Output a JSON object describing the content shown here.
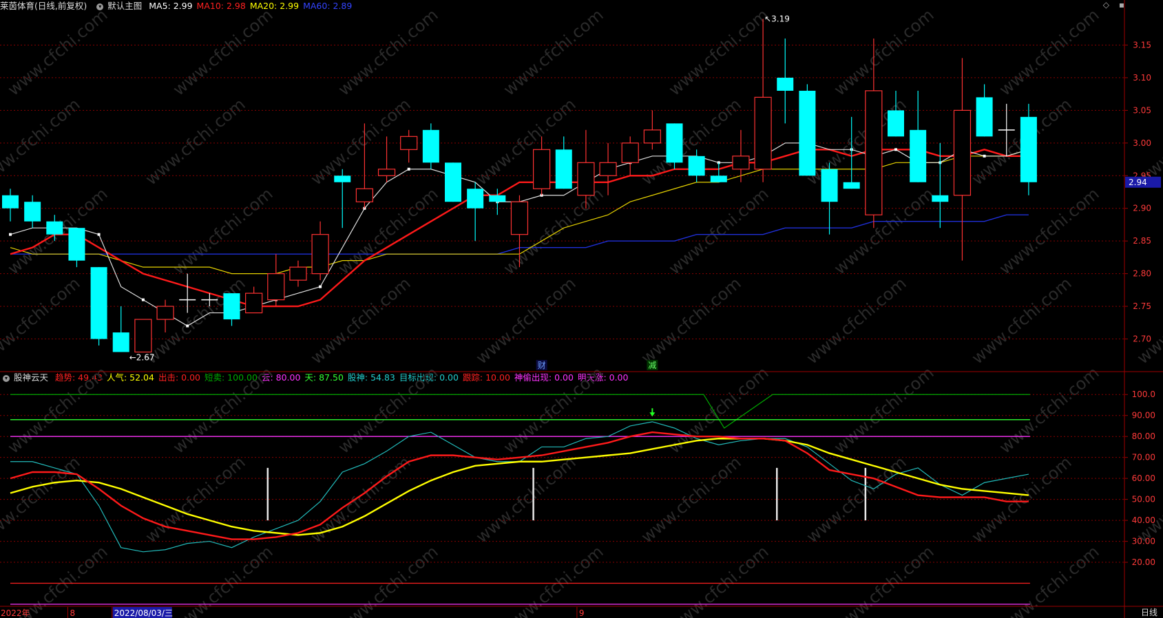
{
  "header": {
    "stock_name": "莱茵体育",
    "mode": "(日线,前复权)",
    "chart_mode": "默认主图",
    "ma": [
      {
        "label": "MA5:",
        "value": "2.99",
        "color": "#ffffff"
      },
      {
        "label": "MA10:",
        "value": "2.98",
        "color": "#ff2020"
      },
      {
        "label": "MA20:",
        "value": "2.99",
        "color": "#ffff00"
      },
      {
        "label": "MA60:",
        "value": "2.89",
        "color": "#3344ff"
      }
    ]
  },
  "window_controls": {
    "diamond": "◇",
    "close": "▪"
  },
  "indicator_header": {
    "name": "股神云天",
    "items": [
      {
        "label": "趋势:",
        "value": "49.43",
        "color": "#ff2020"
      },
      {
        "label": "人气:",
        "value": "52.04",
        "color": "#ffff00"
      },
      {
        "label": "出击:",
        "value": "0.00",
        "color": "#ff2020"
      },
      {
        "label": "短卖:",
        "value": "100.00",
        "color": "#00aa00"
      },
      {
        "label": "云:",
        "value": "80.00",
        "color": "#ff33ff"
      },
      {
        "label": "天:",
        "value": "87.50",
        "color": "#33ff33"
      },
      {
        "label": "股神:",
        "value": "54.83",
        "color": "#22cccc"
      },
      {
        "label": "目标出现:",
        "value": "0.00",
        "color": "#22cccc"
      },
      {
        "label": "跟踪:",
        "value": "10.00",
        "color": "#ff2020"
      },
      {
        "label": "神偷出现:",
        "value": "0.00",
        "color": "#ff33ff"
      },
      {
        "label": "明天涨:",
        "value": "0.00",
        "color": "#ff33ff"
      }
    ]
  },
  "price_axis": {
    "min": 2.65,
    "max": 3.2,
    "ticks": [
      "3.15",
      "3.10",
      "3.05",
      "3.00",
      "2.95",
      "2.90",
      "2.85",
      "2.80",
      "2.75",
      "2.70"
    ],
    "current_price": "2.94"
  },
  "indicator_axis": {
    "ticks": [
      "100.0",
      "90.00",
      "80.00",
      "70.00",
      "60.00",
      "50.00",
      "40.00",
      "30.00",
      "20.00"
    ]
  },
  "annotations": {
    "high": "3.19",
    "low": "←2.67",
    "high_prefix": "↖"
  },
  "event_markers": [
    {
      "text": "财",
      "index": 24
    },
    {
      "text": "减",
      "index": 29
    }
  ],
  "date_axis": {
    "labels": [
      {
        "text": "2022年",
        "index": 0
      },
      {
        "text": "8",
        "index": 3
      },
      {
        "text": "2022/08/03/三",
        "index": 5,
        "highlight": true
      },
      {
        "text": "9",
        "index": 26
      }
    ],
    "period": "日线"
  },
  "watermark": "www.cfchi.com",
  "colors": {
    "up": "#ff3232",
    "down": "#00ffff",
    "doji": "#ffffff",
    "grid": "#8b0000",
    "border": "#a00000"
  },
  "chart_data": {
    "type": "candlestick",
    "candles": [
      [
        2.92,
        2.93,
        2.88,
        2.9
      ],
      [
        2.91,
        2.92,
        2.87,
        2.88
      ],
      [
        2.88,
        2.89,
        2.85,
        2.86
      ],
      [
        2.87,
        2.87,
        2.81,
        2.82
      ],
      [
        2.81,
        2.81,
        2.69,
        2.7
      ],
      [
        2.71,
        2.75,
        2.68,
        2.68
      ],
      [
        2.68,
        2.73,
        2.68,
        2.73
      ],
      [
        2.73,
        2.76,
        2.71,
        2.75
      ],
      [
        2.76,
        2.8,
        2.74,
        2.76
      ],
      [
        2.76,
        2.77,
        2.75,
        2.76
      ],
      [
        2.77,
        2.77,
        2.72,
        2.73
      ],
      [
        2.74,
        2.78,
        2.74,
        2.77
      ],
      [
        2.76,
        2.83,
        2.75,
        2.8
      ],
      [
        2.79,
        2.82,
        2.78,
        2.81
      ],
      [
        2.8,
        2.88,
        2.79,
        2.86
      ],
      [
        2.95,
        2.96,
        2.87,
        2.94
      ],
      [
        2.91,
        3.03,
        2.9,
        2.93
      ],
      [
        2.95,
        3.01,
        2.94,
        2.96
      ],
      [
        2.99,
        3.02,
        2.97,
        3.01
      ],
      [
        3.02,
        3.03,
        2.96,
        2.97
      ],
      [
        2.97,
        2.97,
        2.91,
        2.91
      ],
      [
        2.93,
        2.94,
        2.85,
        2.9
      ],
      [
        2.92,
        2.93,
        2.89,
        2.91
      ],
      [
        2.86,
        2.92,
        2.81,
        2.91
      ],
      [
        2.93,
        3.01,
        2.92,
        2.99
      ],
      [
        2.99,
        3.01,
        2.93,
        2.93
      ],
      [
        2.92,
        3.02,
        2.9,
        2.97
      ],
      [
        2.95,
        3.0,
        2.92,
        2.97
      ],
      [
        2.97,
        3.01,
        2.95,
        3.0
      ],
      [
        3.0,
        3.05,
        2.99,
        3.02
      ],
      [
        3.03,
        3.03,
        2.96,
        2.97
      ],
      [
        2.98,
        2.99,
        2.94,
        2.95
      ],
      [
        2.95,
        2.97,
        2.94,
        2.94
      ],
      [
        2.96,
        3.02,
        2.94,
        2.98
      ],
      [
        2.96,
        3.19,
        2.94,
        3.07
      ],
      [
        3.1,
        3.16,
        3.03,
        3.08
      ],
      [
        3.08,
        3.09,
        2.95,
        2.95
      ],
      [
        2.96,
        2.97,
        2.86,
        2.91
      ],
      [
        2.94,
        3.04,
        2.93,
        2.93
      ],
      [
        2.89,
        3.16,
        2.87,
        3.08
      ],
      [
        3.05,
        3.08,
        3.01,
        3.01
      ],
      [
        3.02,
        3.08,
        2.94,
        2.94
      ],
      [
        2.92,
        3.0,
        2.87,
        2.91
      ],
      [
        2.92,
        3.13,
        2.82,
        3.05
      ],
      [
        3.07,
        3.09,
        3.01,
        3.01
      ],
      [
        3.02,
        3.06,
        2.98,
        3.02
      ],
      [
        3.04,
        3.06,
        2.92,
        2.94
      ]
    ],
    "ma5": [
      2.86,
      2.87,
      2.87,
      2.87,
      2.86,
      2.78,
      2.76,
      2.74,
      2.72,
      2.74,
      2.74,
      2.75,
      2.76,
      2.77,
      2.78,
      2.84,
      2.9,
      2.94,
      2.96,
      2.96,
      2.95,
      2.94,
      2.91,
      2.91,
      2.92,
      2.92,
      2.94,
      2.96,
      2.97,
      2.98,
      2.98,
      2.98,
      2.97,
      2.97,
      2.98,
      3.0,
      3.0,
      2.99,
      2.99,
      2.98,
      2.99,
      2.97,
      2.97,
      2.99,
      2.98,
      2.98,
      2.99
    ],
    "ma10": [
      2.83,
      2.84,
      2.86,
      2.86,
      2.84,
      2.82,
      2.8,
      2.79,
      2.78,
      2.77,
      2.76,
      2.75,
      2.75,
      2.75,
      2.76,
      2.79,
      2.82,
      2.84,
      2.86,
      2.88,
      2.9,
      2.92,
      2.92,
      2.94,
      2.94,
      2.94,
      2.94,
      2.94,
      2.95,
      2.95,
      2.96,
      2.96,
      2.96,
      2.97,
      2.97,
      2.98,
      2.99,
      2.99,
      2.98,
      2.99,
      2.99,
      2.99,
      2.98,
      2.98,
      2.99,
      2.98,
      2.98
    ],
    "ma20": [
      2.84,
      2.83,
      2.83,
      2.83,
      2.83,
      2.82,
      2.81,
      2.81,
      2.81,
      2.81,
      2.8,
      2.8,
      2.8,
      2.81,
      2.81,
      2.82,
      2.82,
      2.83,
      2.83,
      2.83,
      2.83,
      2.83,
      2.83,
      2.83,
      2.85,
      2.87,
      2.88,
      2.89,
      2.91,
      2.92,
      2.93,
      2.94,
      2.94,
      2.95,
      2.96,
      2.96,
      2.96,
      2.96,
      2.96,
      2.96,
      2.97,
      2.97,
      2.97,
      2.98,
      2.98,
      2.98,
      2.99
    ],
    "ma60": [
      2.83,
      2.83,
      2.83,
      2.83,
      2.83,
      2.83,
      2.83,
      2.83,
      2.83,
      2.83,
      2.83,
      2.83,
      2.83,
      2.83,
      2.83,
      2.83,
      2.83,
      2.83,
      2.83,
      2.83,
      2.83,
      2.83,
      2.83,
      2.84,
      2.84,
      2.84,
      2.84,
      2.85,
      2.85,
      2.85,
      2.85,
      2.86,
      2.86,
      2.86,
      2.86,
      2.87,
      2.87,
      2.87,
      2.87,
      2.88,
      2.88,
      2.88,
      2.88,
      2.88,
      2.88,
      2.89,
      2.89
    ],
    "indicator": {
      "ymin": 0,
      "ymax": 105,
      "trend": [
        60,
        63,
        63,
        62,
        55,
        47,
        41,
        37,
        35,
        33,
        31,
        31,
        32,
        34,
        38,
        46,
        53,
        61,
        68,
        71,
        71,
        70,
        69,
        70,
        71,
        73,
        75,
        77,
        80,
        82,
        81,
        80,
        80,
        79,
        79,
        78,
        72,
        64,
        62,
        60,
        56,
        52,
        51,
        51,
        51,
        49,
        49
      ],
      "renqi": [
        53,
        56,
        58,
        59,
        58,
        55,
        51,
        47,
        43,
        40,
        37,
        35,
        34,
        33,
        34,
        37,
        42,
        48,
        54,
        59,
        63,
        66,
        67,
        68,
        68,
        69,
        70,
        71,
        72,
        74,
        76,
        78,
        79,
        79,
        79,
        78,
        76,
        72,
        69,
        66,
        63,
        60,
        57,
        55,
        54,
        53,
        52
      ],
      "gushen": [
        68,
        68,
        65,
        62,
        47,
        27,
        25,
        26,
        29,
        30,
        27,
        32,
        36,
        40,
        49,
        63,
        67,
        73,
        80,
        82,
        76,
        70,
        68,
        68,
        75,
        75,
        79,
        80,
        85,
        87,
        84,
        79,
        76,
        78,
        79,
        79,
        75,
        67,
        59,
        55,
        62,
        65,
        57,
        52,
        58,
        60,
        62
      ],
      "guide_lines": [
        {
          "value": 100,
          "color": "#00aa00"
        },
        {
          "value": 88,
          "color": "#33ff33"
        },
        {
          "value": 80,
          "color": "#ff33ff"
        },
        {
          "value": 10,
          "color": "#ff2020"
        },
        {
          "value": 0,
          "color": "#ff33ff"
        }
      ],
      "white_bars": [
        12,
        24,
        35,
        39
      ],
      "arrow_index": 29
    }
  }
}
